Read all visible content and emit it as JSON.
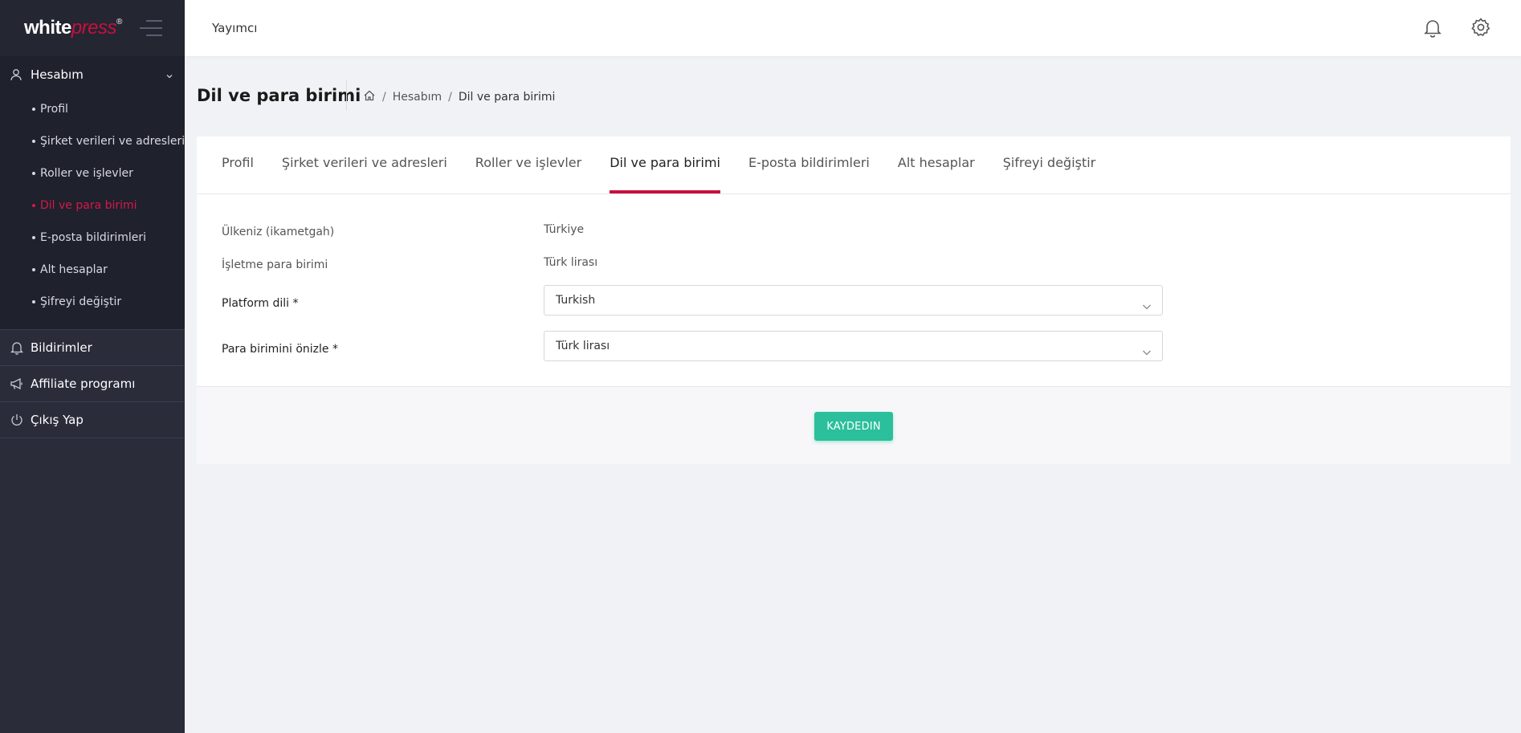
{
  "brand": {
    "logo_white": "white",
    "logo_press": "press",
    "logo_reg": "®"
  },
  "topbar": {
    "title": "Yayımcı"
  },
  "sidebar": {
    "account": {
      "label": "Hesabım",
      "items": [
        {
          "label": "Profil"
        },
        {
          "label": "Şirket verileri ve adresleri"
        },
        {
          "label": "Roller ve işlevler"
        },
        {
          "label": "Dil ve para birimi"
        },
        {
          "label": "E-posta bildirimleri"
        },
        {
          "label": "Alt hesaplar"
        },
        {
          "label": "Şifreyi değiştir"
        }
      ]
    },
    "notifications": {
      "label": "Bildirimler"
    },
    "affiliate": {
      "label": "Affiliate programı"
    },
    "logout": {
      "label": "Çıkış Yap"
    }
  },
  "page": {
    "title": "Dil ve para birimi",
    "breadcrumb": {
      "parent": "Hesabım",
      "current": "Dil ve para birimi"
    }
  },
  "tabs": [
    {
      "label": "Profil"
    },
    {
      "label": "Şirket verileri ve adresleri"
    },
    {
      "label": "Roller ve işlevler"
    },
    {
      "label": "Dil ve para birimi"
    },
    {
      "label": "E-posta bildirimleri"
    },
    {
      "label": "Alt hesaplar"
    },
    {
      "label": "Şifreyi değiştir"
    }
  ],
  "form": {
    "country": {
      "label": "Ülkeniz (ikametgah)",
      "value": "Türkiye"
    },
    "currency": {
      "label": "İşletme para birimi",
      "value": "Türk lirası"
    },
    "platform_language": {
      "label": "Platform dili *",
      "value": "Turkish"
    },
    "preview_currency": {
      "label": "Para birimini önizle *",
      "value": "Türk lirası"
    }
  },
  "actions": {
    "save_label": "KAYDEDIN"
  },
  "colors": {
    "accent": "#c8103e",
    "save": "#2bbf9b",
    "sidebar": "#2a2c3a"
  }
}
